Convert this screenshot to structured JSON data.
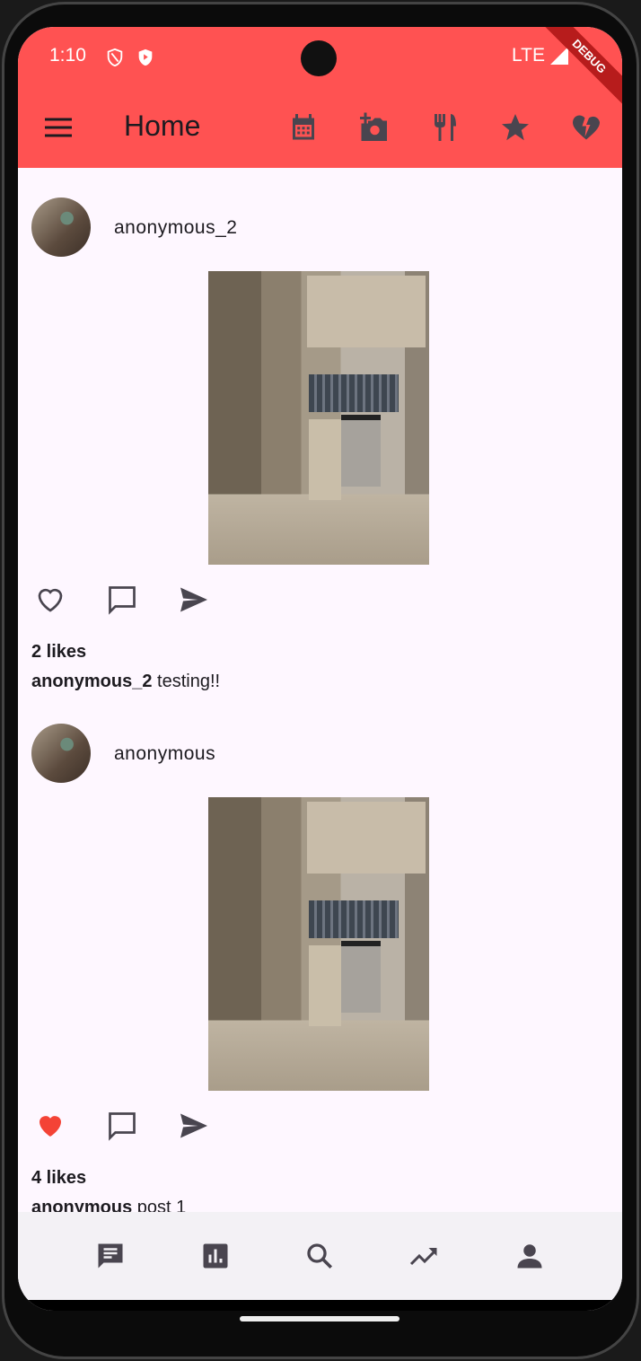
{
  "status_bar": {
    "time": "1:10",
    "network": "LTE",
    "debug_banner": "DEBUG"
  },
  "app_bar": {
    "title": "Home",
    "actions": [
      "calendar-icon",
      "add-a-photo-icon",
      "restaurant-icon",
      "star-icon",
      "heart-broken-icon"
    ]
  },
  "accent_color": "#ff5252",
  "posts": [
    {
      "username": "anonymous_2",
      "likes": "2 likes",
      "caption_user": "anonymous_2",
      "caption_text": " testing!!",
      "liked": false
    },
    {
      "username": "anonymous",
      "likes": "4 likes",
      "caption_user": "anonymous",
      "caption_text": " post 1",
      "liked": true
    }
  ],
  "bottom_nav": [
    "chat-icon",
    "bar-chart-icon",
    "search-icon",
    "trending-up-icon",
    "person-icon"
  ]
}
